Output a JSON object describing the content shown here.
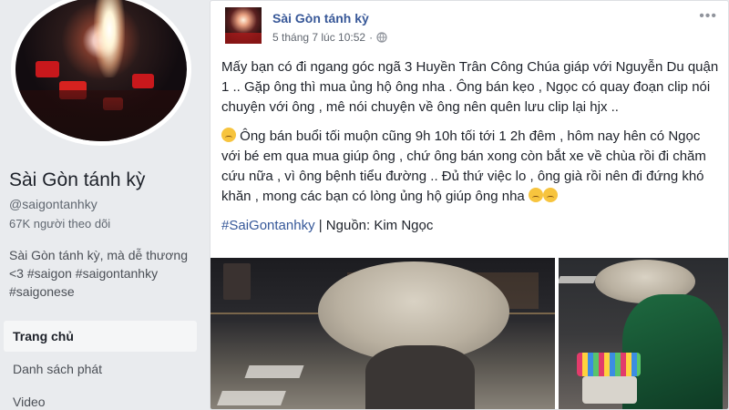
{
  "page": {
    "name": "Sài Gòn tánh kỳ",
    "handle": "@saigontanhky",
    "followers": "67K người theo dõi",
    "bio": "Sài Gòn tánh kỳ, mà dễ thương <3 #saigon #saigontanhky #saigonese"
  },
  "nav": {
    "items": [
      {
        "label": "Trang chủ"
      },
      {
        "label": "Danh sách phát"
      },
      {
        "label": "Video"
      }
    ]
  },
  "post": {
    "author": "Sài Gòn tánh kỳ",
    "timestamp": "5 tháng 7 lúc 10:52",
    "paragraph1": "Mấy bạn có đi ngang góc ngã 3 Huyền Trân Công Chúa giáp với Nguyễn Du quận 1 .. Gặp ông thì mua ủng hộ ông nha . Ông bán kẹo , Ngọc có quay đoạn clip nói chuyện với ông , mê nói chuyện về ông nên quên lưu clip lại hjx ..",
    "paragraph2": "Ông bán buổi tối muộn cũng 9h 10h tối tới 1 2h đêm , hôm nay hên có Ngọc với bé em qua mua giúp ông , chứ ông bán xong còn bắt xe về chùa rồi đi chăm cứu nữa , vì ông bệnh tiểu đường .. Đủ thứ việc lo , ông già rồi nên đi đứng khó khăn , mong các bạn có lòng ủng hộ giúp ông nha",
    "hashtag": "#SaiGontanhky",
    "source": " | Nguồn: Kim Ngọc"
  },
  "icons": {
    "privacy": "globe-icon",
    "options": "more-options-icon",
    "emoji": "sad-face-emoji-icon"
  },
  "colors": {
    "link": "#385898",
    "background": "#e9ebee",
    "text": "#1d2129"
  }
}
